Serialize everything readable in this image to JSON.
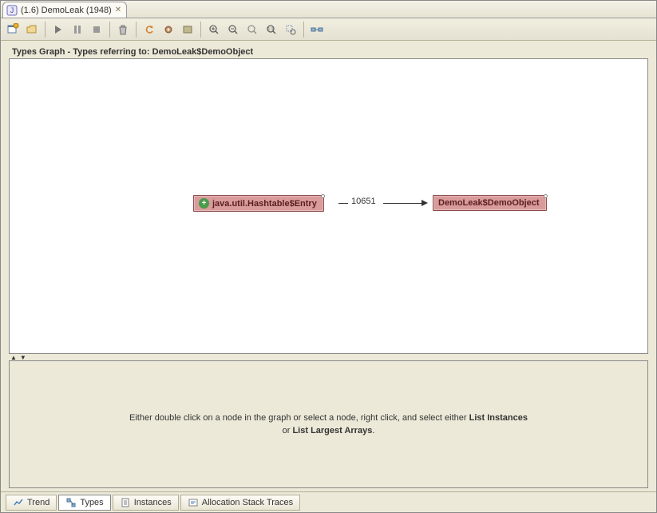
{
  "editor_tab": {
    "title": "(1.6) DemoLeak (1948)"
  },
  "panel": {
    "title": "Types Graph - Types referring to: DemoLeak$DemoObject"
  },
  "graph": {
    "node_source": "java.util.Hashtable$Entry",
    "edge_count": "10651",
    "node_target": "DemoLeak$DemoObject"
  },
  "hint": {
    "line1_prefix": "Either double click on a node in the graph or select a node, right click, and select either ",
    "bold1": "List Instances",
    "line2_prefix": "or ",
    "bold2": "List Largest Arrays",
    "suffix": "."
  },
  "bottom_tabs": {
    "trend": "Trend",
    "types": "Types",
    "instances": "Instances",
    "alloc": "Allocation Stack Traces"
  }
}
